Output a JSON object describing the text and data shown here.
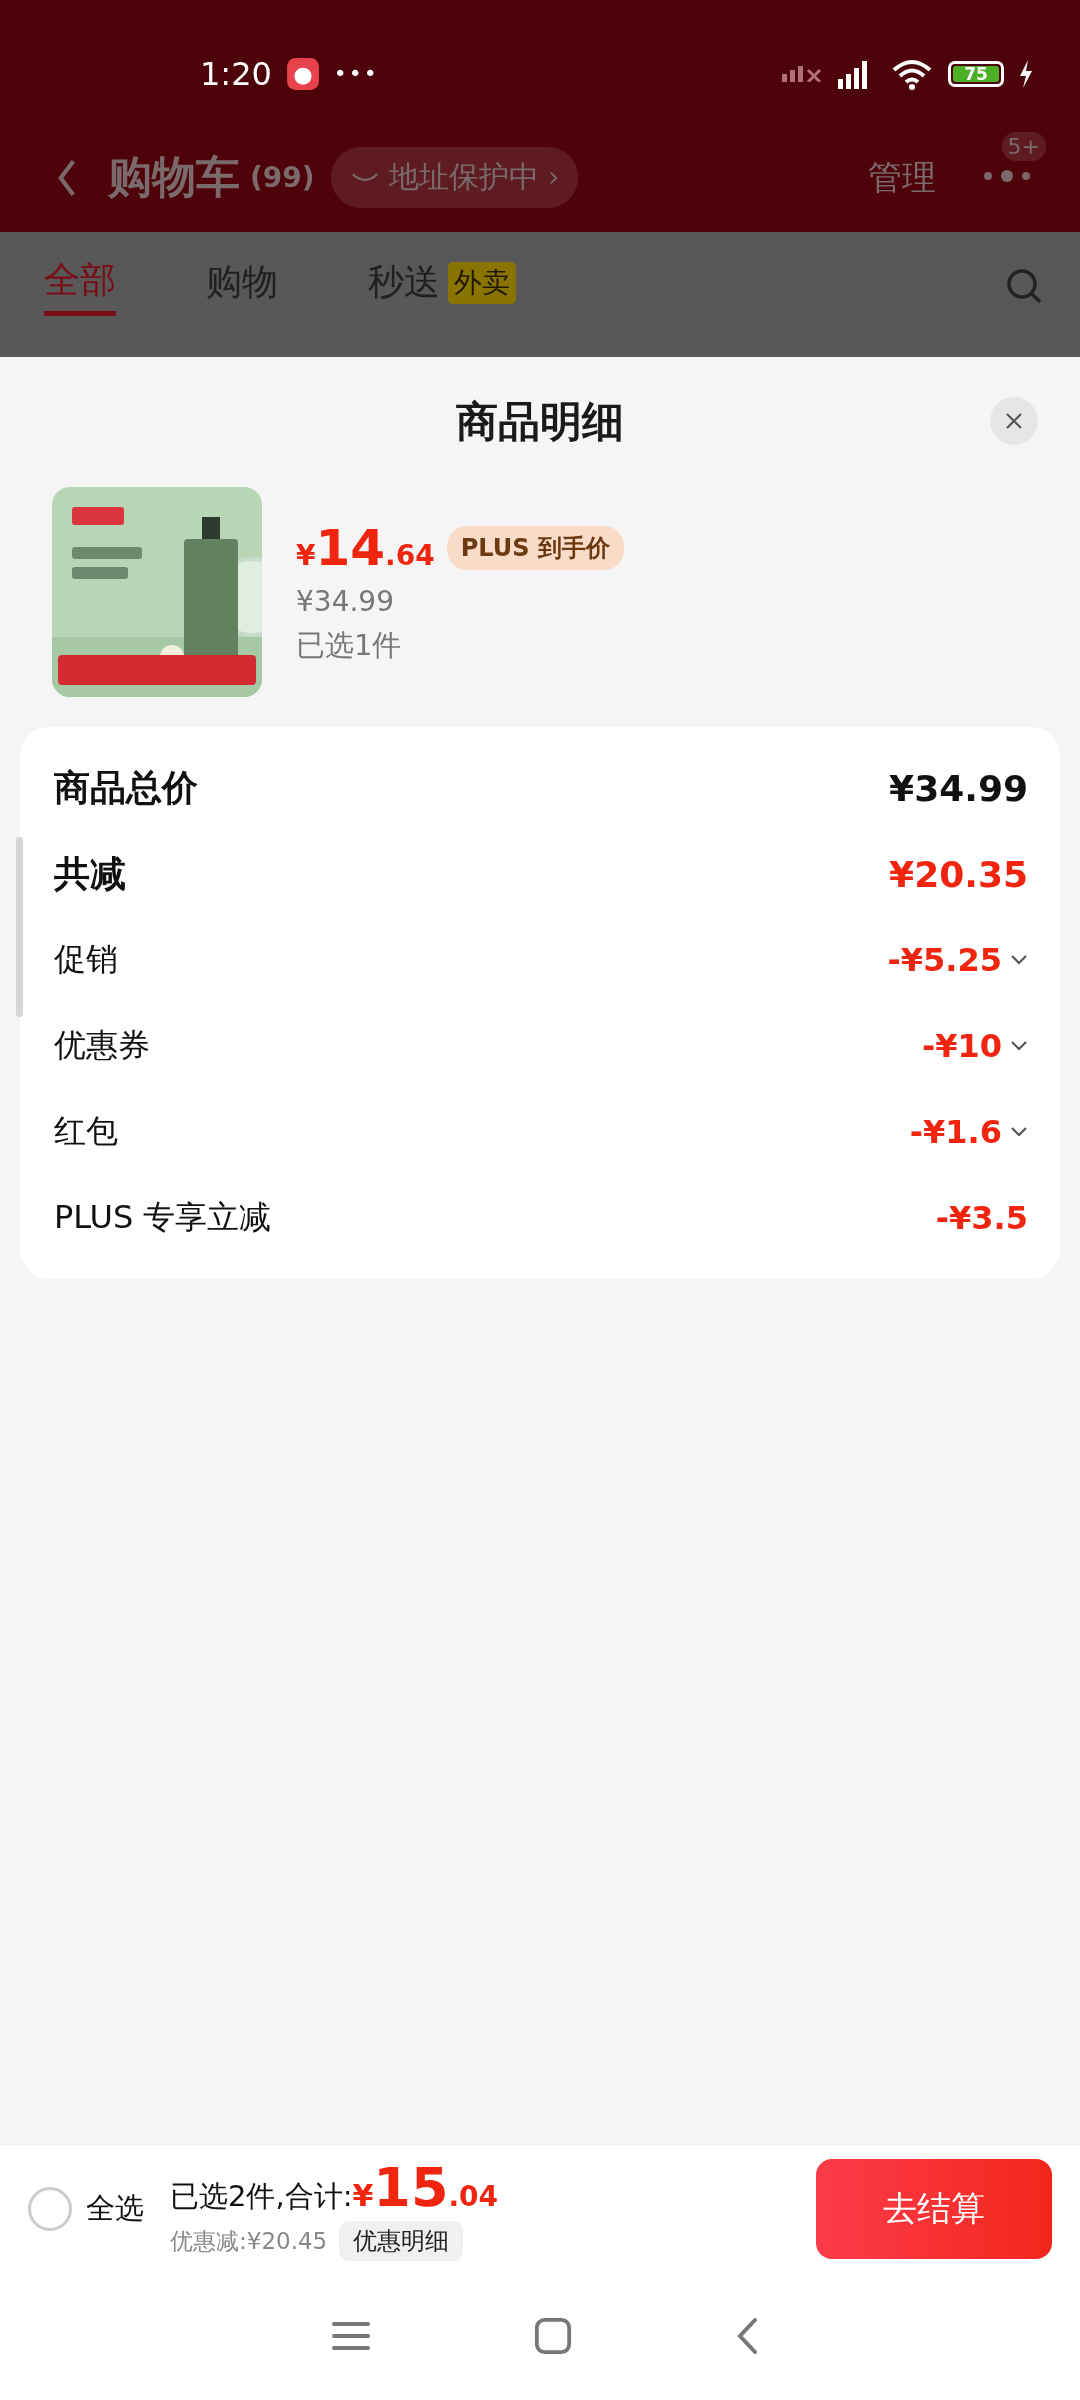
{
  "status_bar": {
    "time": "1:20",
    "more": "•••",
    "battery": "75"
  },
  "header": {
    "title": "购物车",
    "count": "(99)",
    "address_badge": "地址保护中",
    "manage": "管理",
    "notification_badge": "5+"
  },
  "tabs": [
    {
      "label": "全部",
      "selected": true
    },
    {
      "label": "购物",
      "selected": false
    },
    {
      "label": "秒送",
      "selected": false,
      "badge": "外卖"
    }
  ],
  "sheet": {
    "title": "商品明细",
    "product": {
      "price": {
        "symbol": "¥",
        "integer": "14",
        "decimal": ".64"
      },
      "price_tag": "PLUS 到手价",
      "original_price": "¥34.99",
      "selected_count": "已选1件"
    },
    "breakdown": [
      {
        "kind": "total",
        "label": "商品总价",
        "value": "¥34.99",
        "expandable": false
      },
      {
        "kind": "reduction",
        "label": "共减",
        "value": "¥20.35",
        "expandable": false
      },
      {
        "kind": "detail",
        "label": "促销",
        "value": "-¥5.25",
        "expandable": true
      },
      {
        "kind": "detail",
        "label": "优惠券",
        "value": "-¥10",
        "expandable": true
      },
      {
        "kind": "detail",
        "label": "红包",
        "value": "-¥1.6",
        "expandable": true
      },
      {
        "kind": "detail",
        "label": "PLUS 专享立减",
        "value": "-¥3.5",
        "expandable": false
      }
    ]
  },
  "checkout_bar": {
    "select_all": {
      "label": "全选",
      "checked": false
    },
    "summary": "已选2件,合计:",
    "total": {
      "symbol": "¥",
      "integer": "15",
      "decimal": ".04"
    },
    "discount": "优惠减:¥20.45",
    "details_button": "优惠明细",
    "checkout_button": "去结算"
  }
}
